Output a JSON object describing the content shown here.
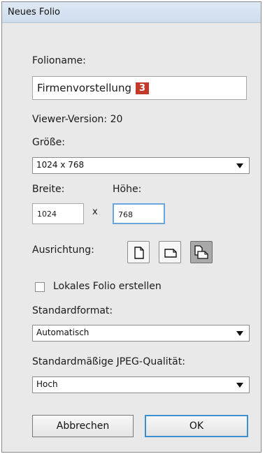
{
  "window": {
    "title": "Neues Folio"
  },
  "folio_name": {
    "label": "Folioname:",
    "value": "Firmenvorstellung",
    "badge": "3"
  },
  "viewer_version": {
    "label": "Viewer-Version:",
    "value": "20"
  },
  "size": {
    "label": "Größe:",
    "selected": "1024 x 768"
  },
  "width": {
    "label": "Breite:",
    "value": "1024"
  },
  "height": {
    "label": "Höhe:",
    "value": "768"
  },
  "times_sign": "x",
  "orientation": {
    "label": "Ausrichtung:",
    "options": [
      "portrait-icon",
      "landscape-icon",
      "both-orientations-icon"
    ],
    "selected": "both-orientations-icon"
  },
  "local_folio": {
    "label": "Lokales Folio erstellen",
    "checked": false
  },
  "default_format": {
    "label": "Standardformat:",
    "selected": "Automatisch"
  },
  "jpeg_quality": {
    "label": "Standardmäßige JPEG-Qualität:",
    "selected": "Hoch"
  },
  "buttons": {
    "cancel": "Abbrechen",
    "ok": "OK"
  },
  "colors": {
    "badge": "#c33a2a",
    "focus_border": "#6aa6dc",
    "ok_border": "#3c8fd1"
  }
}
